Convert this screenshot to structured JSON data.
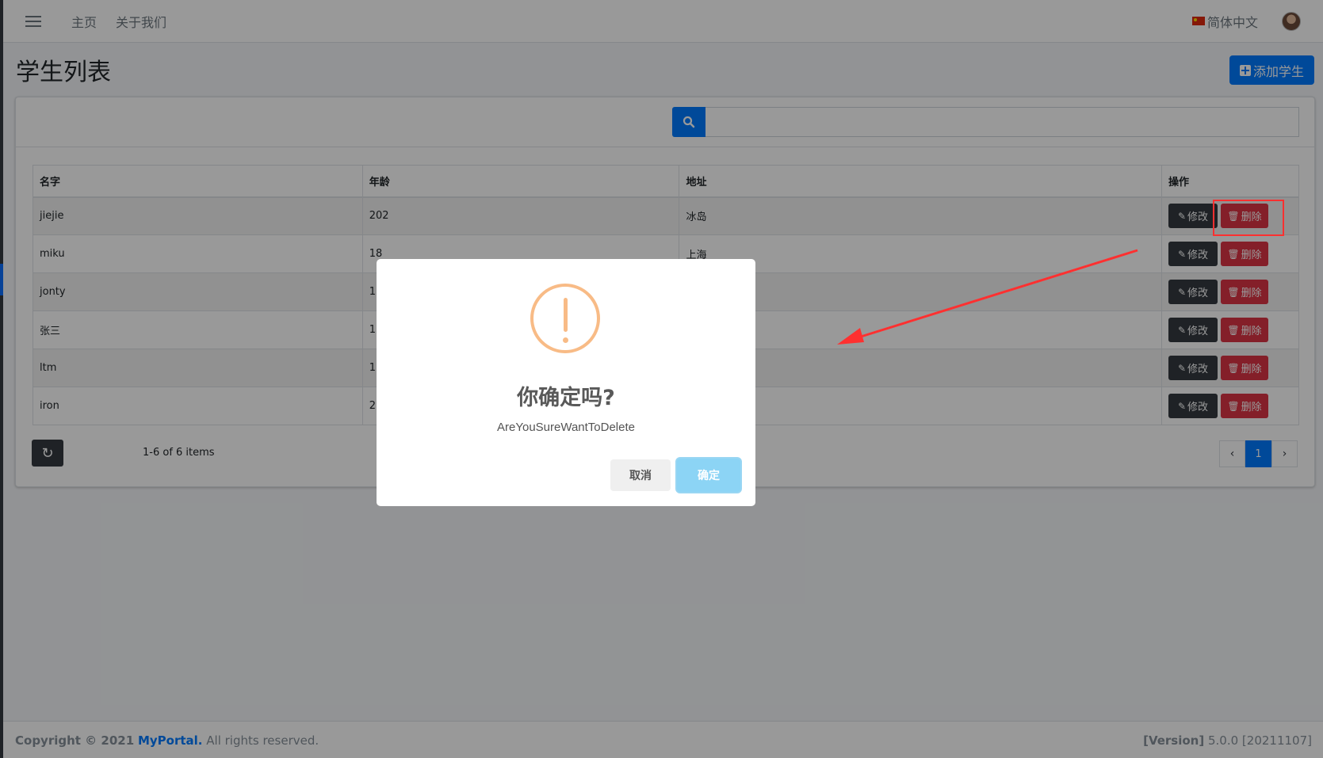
{
  "navbar": {
    "menu_icon": "hamburger-icon",
    "links": [
      "主页",
      "关于我们"
    ],
    "language": "简体中文",
    "language_flag": "china-flag-icon",
    "avatar": "user-avatar"
  },
  "page": {
    "title": "学生列表",
    "add_button": "添加学生",
    "add_icon": "plus-square-icon"
  },
  "search": {
    "icon": "search-icon",
    "placeholder": ""
  },
  "table": {
    "headers": [
      "名字",
      "年龄",
      "地址",
      "操作"
    ],
    "rows": [
      {
        "name": "jiejie",
        "age": "202",
        "address": "冰岛"
      },
      {
        "name": "miku",
        "age": "18",
        "address": "上海"
      },
      {
        "name": "jonty",
        "age": "1",
        "address": ""
      },
      {
        "name": "张三",
        "age": "1",
        "address": ""
      },
      {
        "name": "ltm",
        "age": "1",
        "address": ""
      },
      {
        "name": "iron",
        "age": "2",
        "address": ""
      }
    ],
    "edit_label": "修改",
    "delete_label": "删除",
    "edit_icon": "pencil-icon",
    "delete_icon": "trash-icon"
  },
  "pagination": {
    "refresh_icon": "refresh-icon",
    "items_info": "1-6 of 6 items",
    "prev_icon": "chevron-left-icon",
    "next_icon": "chevron-right-icon",
    "current_page": "1"
  },
  "footer": {
    "copyright_prefix": "Copyright © 2021",
    "brand": "MyPortal.",
    "rights": "All rights reserved.",
    "version_label": "[Version]",
    "version_value": "5.0.0 [20211107]"
  },
  "dialog": {
    "icon": "warning-icon",
    "title": "你确定吗?",
    "text": "AreYouSureWantToDelete",
    "cancel_label": "取消",
    "confirm_label": "确定"
  },
  "colors": {
    "primary": "#007bff",
    "danger": "#dc3545",
    "dark": "#343a40",
    "warning_icon": "#f8bb86",
    "confirm_button": "#8cd4f5",
    "annotation": "#ff3030"
  }
}
